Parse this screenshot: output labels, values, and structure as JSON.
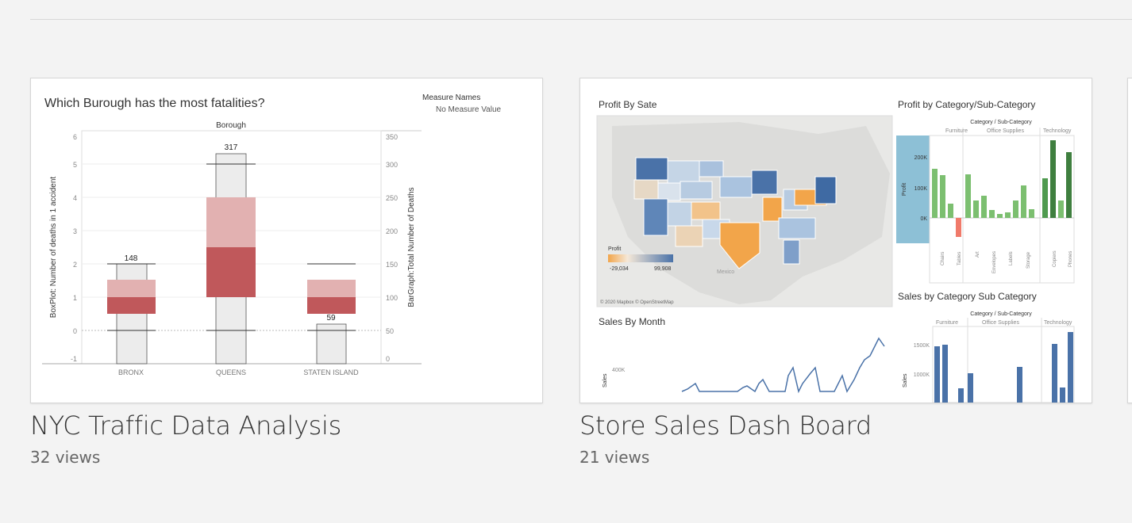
{
  "workbooks": [
    {
      "title": "NYC Traffic Data Analysis",
      "views": "32 views",
      "thumbnail": {
        "chart_title": "Which Burough has the most fatalities?",
        "legend_title": "Measure Names",
        "legend_value": "No Measure Value",
        "column_header": "Borough",
        "left_axis_label": "BoxPlot: Number of deaths in 1 accident",
        "right_axis_label": "BarGraph:Total Number of Deaths",
        "left_ticks": [
          "6",
          "5",
          "4",
          "3",
          "2",
          "1",
          "0",
          "-1"
        ],
        "right_ticks": [
          "350",
          "300",
          "250",
          "200",
          "150",
          "100",
          "50",
          "0"
        ],
        "categories": [
          "BRONX",
          "QUEENS",
          "STATEN ISLAND"
        ],
        "bar_labels": [
          "148",
          "317",
          "59"
        ]
      }
    },
    {
      "title": "Store Sales Dash Board",
      "views": "21 views",
      "thumbnail": {
        "map_title": "Profit By Sate",
        "profit_title": "Profit by Category/Sub-Category",
        "category_header": "Category / Sub-Category",
        "categories": [
          "Furniture",
          "Office Supplies",
          "Technology"
        ],
        "profit_ticks": [
          "200K",
          "100K",
          "0K"
        ],
        "profit_axis": "Profit",
        "subcategories": [
          "Chairs",
          "Tables",
          "Art",
          "Envelopes",
          "Labels",
          "Storage",
          "Copiers",
          "Phones"
        ],
        "map_legend_title": "Profit",
        "map_legend_min": "-29,034",
        "map_legend_max": "99,908",
        "map_credit": "© 2020 Mapbox © OpenStreetMap",
        "map_country": "Mexico",
        "sales_month_title": "Sales By Month",
        "sales_month_tick": "400K",
        "sales_month_axis": "Sales",
        "sales_sub_title": "Sales by Category Sub Category",
        "sales_sub_header": "Category / Sub-Category",
        "sales_sub_ticks": [
          "1500K",
          "1000K"
        ],
        "sales_sub_axis": "Sales"
      }
    }
  ],
  "colors": {
    "background": "#f3f3f3",
    "box_light": "#e2b1b1",
    "box_dark": "#c0585b",
    "bar_fill": "#ececec",
    "profit_green": "#7cbf70",
    "profit_dark_green": "#3f7f3f",
    "profit_red": "#f07a6a",
    "map_blue": "#4a72a8",
    "map_orange": "#f2a54a"
  }
}
